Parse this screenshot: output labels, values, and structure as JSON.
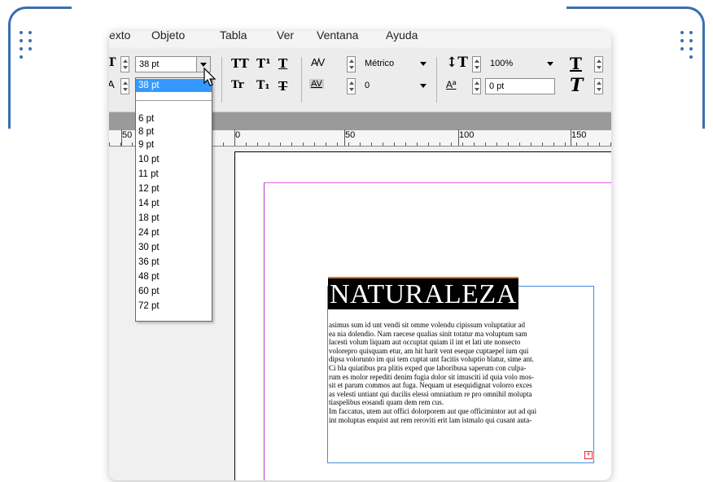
{
  "menubar": {
    "items": [
      "exto",
      "Objeto",
      "Tabla",
      "Ver",
      "Ventana",
      "Ayuda"
    ]
  },
  "toolbar": {
    "font_size_value": "38 pt",
    "tracking_value": "Métrico",
    "kerning_value": "0",
    "scale_value": "100%",
    "baseline_value": "0 pt",
    "buttons": {
      "all_caps": "TT",
      "superscript": "T¹",
      "underline": "T",
      "small_caps": "Tr",
      "subscript": "T₁",
      "strikethrough": "T"
    },
    "icons": [
      "font-size-icon",
      "leading-icon",
      "kerning-icon",
      "tracking-icon",
      "vertical-scale-icon",
      "baseline-shift-icon",
      "char-style-icon",
      "italic-icon"
    ]
  },
  "font_size_dropdown": {
    "selected": "38 pt",
    "options": [
      "6 pt",
      "8 pt",
      "9 pt",
      "10 pt",
      "11 pt",
      "12 pt",
      "14 pt",
      "18 pt",
      "24 pt",
      "30 pt",
      "36 pt",
      "48 pt",
      "60 pt",
      "72 pt"
    ]
  },
  "ruler": {
    "labels": [
      "50",
      "0",
      "50",
      "100",
      "150"
    ]
  },
  "document": {
    "heading": "NATURALEZA",
    "body_lines": [
      "asimus sum id unt vendi sit omme volendu cipissum voluptatiur ad",
      "ea nia dolendio. Nam raecese qualias sinit totatur ma voluptum sam",
      "lacesti volum liquam aut occuptat quiam il int et lati ute nonsecto",
      "volorepro quisquam etur, am hit harit vent eseque cuptaepel ium qui",
      "dipsa volorunto im qui tem cuptat unt facitis voluptio blatur, sime ant.",
      "Ci bla quiatibus pra plitis exped que laboribusa saperum con culpa-",
      "rum es molor repediti denim fugia dolor sit imusciti id quia volo mos-",
      "sit et parum commos aut fuga. Nequam ut esequidignat volorro exces",
      "as velesti untiant qui ducilis elessi omniatium re pro omnihil molupta",
      "tiaspelibus eosandi quam dem rem cus.",
      "Im faccatus, utem aut offici dolorporem aut que officimintor aut ad qui",
      "int moluptas enquist aut rem reroviti erit lam istmalo qui cusant auta-"
    ],
    "overset_marker": "+"
  },
  "colors": {
    "frame_accent": "#3a6fb0",
    "selection": "#3399ff",
    "margin_guide": "#b43cd2",
    "text_frame": "#3f8ee0",
    "overset": "#e22233"
  }
}
